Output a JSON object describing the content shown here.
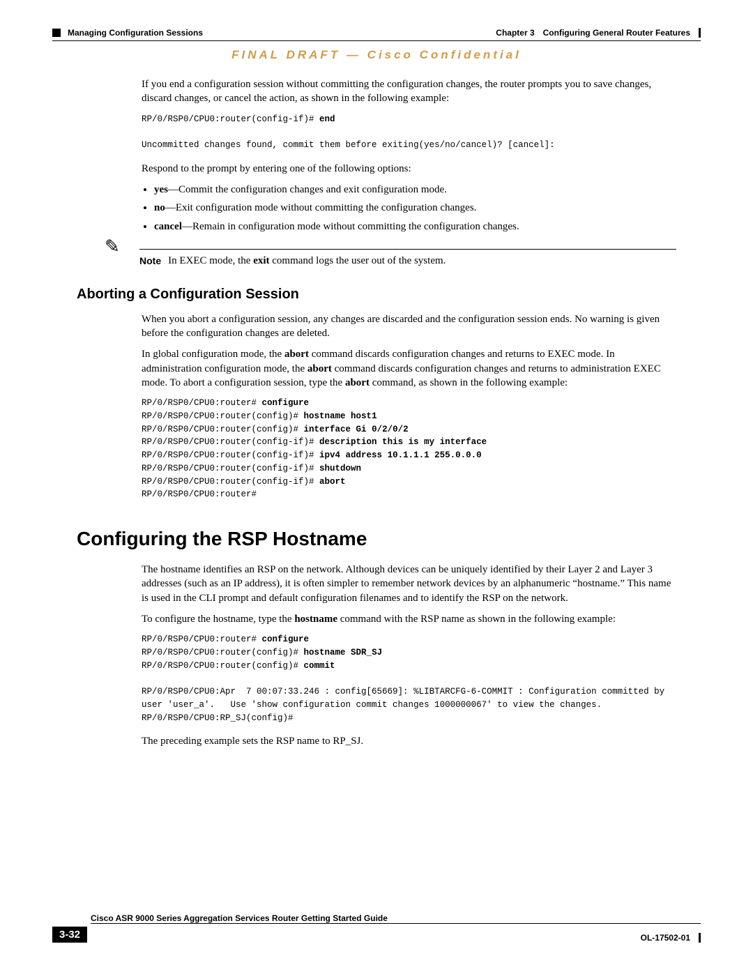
{
  "header": {
    "chapter_label": "Chapter 3",
    "chapter_title": "Configuring General Router Features",
    "section_title": "Managing Configuration Sessions"
  },
  "watermark": "FINAL DRAFT — Cisco Confidential",
  "p1": "If you end a configuration session without committing the configuration changes, the router prompts you to save changes, discard changes, or cancel the action, as shown in the following example:",
  "code1_pre": "RP/0/RSP0/CPU0:router(config-if)# ",
  "code1_cmd": "end",
  "code1_post": "\n\nUncommitted changes found, commit them before exiting(yes/no/cancel)? [cancel]:",
  "p2": "Respond to the prompt by entering one of the following options:",
  "bullets": [
    {
      "term": "yes",
      "desc": "—Commit the configuration changes and exit configuration mode."
    },
    {
      "term": "no",
      "desc": "—Exit configuration mode without committing the configuration changes."
    },
    {
      "term": "cancel",
      "desc": "—Remain in configuration mode without committing the configuration changes."
    }
  ],
  "note": {
    "label": "Note",
    "text_a": "In EXEC mode, the ",
    "text_b": "exit",
    "text_c": " command logs the user out of the system."
  },
  "h2_abort": "Aborting a Configuration Session",
  "abort_p1": "When you abort a configuration session, any changes are discarded and the configuration session ends. No warning is given before the configuration changes are deleted.",
  "abort_p2_a": "In global configuration mode, the ",
  "abort_p2_b": "abort",
  "abort_p2_c": " command discards configuration changes and returns to EXEC mode. In administration configuration mode, the ",
  "abort_p2_d": "abort",
  "abort_p2_e": " command discards configuration changes and returns to administration EXEC mode. To abort a configuration session, type the ",
  "abort_p2_f": "abort",
  "abort_p2_g": " command, as shown in the following example:",
  "code2": {
    "l1p": "RP/0/RSP0/CPU0:router# ",
    "l1c": "configure",
    "l2p": "RP/0/RSP0/CPU0:router(config)# ",
    "l2c": "hostname host1",
    "l3p": "RP/0/RSP0/CPU0:router(config)# ",
    "l3c": "interface Gi 0/2/0/2",
    "l4p": "RP/0/RSP0/CPU0:router(config-if)# ",
    "l4c": "description this is my interface",
    "l5p": "RP/0/RSP0/CPU0:router(config-if)# ",
    "l5c": "ipv4 address 10.1.1.1 255.0.0.0",
    "l6p": "RP/0/RSP0/CPU0:router(config-if)# ",
    "l6c": "shutdown",
    "l7p": "RP/0/RSP0/CPU0:router(config-if)# ",
    "l7c": "abort",
    "l8": "RP/0/RSP0/CPU0:router#"
  },
  "h1_rsp": "Configuring the RSP Hostname",
  "rsp_p1": "The hostname identifies an RSP on the network. Although devices can be uniquely identified by their Layer 2 and Layer 3 addresses (such as an IP address), it is often simpler to remember network devices by an alphanumeric “hostname.” This name is used in the CLI prompt and default configuration filenames and to identify the RSP on the network.",
  "rsp_p2_a": "To configure the hostname, type the ",
  "rsp_p2_b": "hostname",
  "rsp_p2_c": " command with the RSP name as shown in the following example:",
  "code3": {
    "l1p": "RP/0/RSP0/CPU0:router# ",
    "l1c": "configure",
    "l2p": "RP/0/RSP0/CPU0:router(config)# ",
    "l2c": "hostname SDR_SJ",
    "l3p": "RP/0/RSP0/CPU0:router(config)# ",
    "l3c": "commit",
    "rest": "\n\nRP/0/RSP0/CPU0:Apr  7 00:07:33.246 : config[65669]: %LIBTARCFG-6-COMMIT : Configuration committed by user 'user_a'.   Use 'show configuration commit changes 1000000067' to view the changes.\nRP/0/RSP0/CPU0:RP_SJ(config)#"
  },
  "rsp_p3": "The preceding example sets the RSP name to RP_SJ.",
  "footer": {
    "title": "Cisco ASR 9000 Series Aggregation Services Router Getting Started Guide",
    "page": "3-32",
    "docid": "OL-17502-01"
  }
}
